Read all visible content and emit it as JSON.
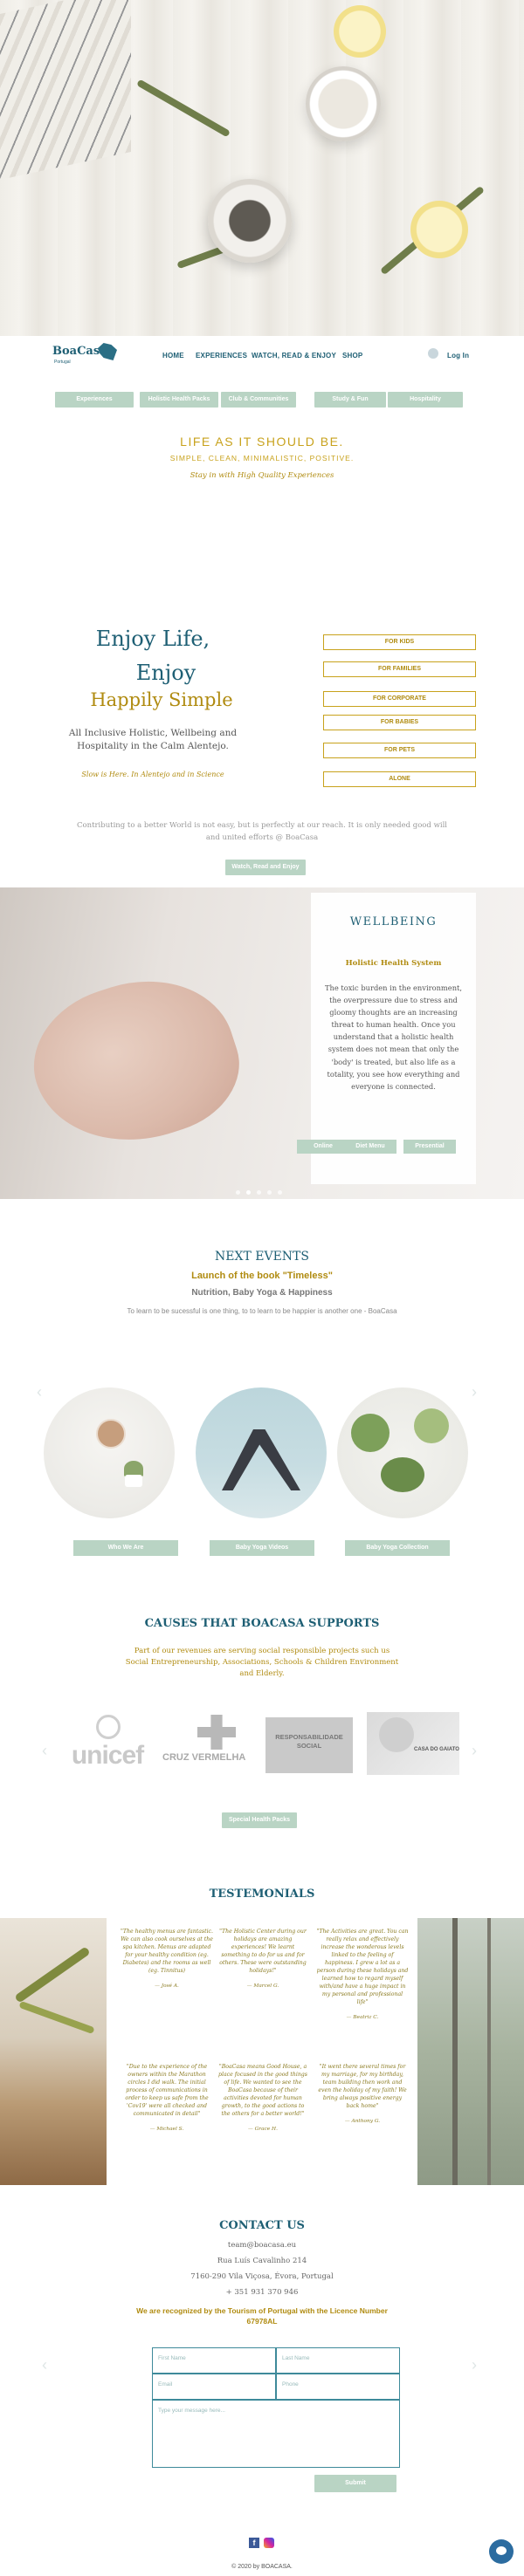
{
  "nav": {
    "logo_text": "BoaCasa",
    "logo_sub": "Portugal",
    "links": [
      "HOME",
      "EXPERIENCES",
      "WATCH, READ & ENJOY",
      "SHOP"
    ],
    "login": "Log In"
  },
  "tabs": [
    "Experiences",
    "Holistic Health Packs",
    "Club & Communities",
    "Study & Fun",
    "Hospitality"
  ],
  "intro": {
    "title": "LIFE AS IT SHOULD BE.",
    "subtitle": "SIMPLE, CLEAN, MINIMALISTIC, POSITIVE.",
    "tagline": "Stay in with High Quality Experiences"
  },
  "enjoy": {
    "line1": "Enjoy Life,",
    "line2": "Enjoy",
    "line3": "Happily Simple",
    "desc": "All Inclusive Holistic, Wellbeing and Hospitality in the Calm Alentejo.",
    "slogan": "Slow is Here. In Alentejo and in Science",
    "buttons": [
      "FOR KIDS",
      "FOR FAMILIES",
      "FOR CORPORATE",
      "FOR BABIES",
      "FOR PETS",
      "ALONE"
    ],
    "contribution": "Contributing to a better World is not easy, but is perfectly at our reach. It is only needed good will and united efforts @ BoaCasa",
    "cta": "Watch, Read and Enjoy"
  },
  "wellbeing": {
    "title": "WELLBEING",
    "subtitle": "Holistic Health System",
    "body": "The toxic burden in the environment, the overpressure due to stress and gloomy thoughts are an increasing threat to human health. Once you understand that a holistic health system does not mean that only the 'body' is treated, but also life as a totality, you see how everything and everyone is connected.",
    "buttons": [
      "Online",
      "Diet Menu",
      "Presential"
    ]
  },
  "events": {
    "title": "NEXT EVENTS",
    "launch": "Launch of the book \"Timeless\"",
    "sub": "Nutrition, Baby Yoga & Happiness",
    "quote": "To learn to be sucessful is one thing, to to learn to be happier is another one - BoaCasa",
    "buttons": [
      "Who We Are",
      "Baby Yoga Videos",
      "Baby Yoga Collection"
    ]
  },
  "causes": {
    "title": "CAUSES THAT BOACASA SUPPORTS",
    "text": "Part of our revenues are serving social responsible projects such us Social Entrepreneurship, Associations, Schools & Children Environment and Elderly.",
    "logos": [
      "unicef",
      "CRUZ VERMELHA",
      "RESPONSABILIDADE SOCIAL",
      "CASA DO GAIATO"
    ],
    "cta": "Special Health Packs"
  },
  "testimonials": {
    "title": "TESTEMONIALS",
    "items": [
      {
        "text": "\"The healthy menus are fantastic. We can also cook ourselves at the spa kitchen. Menus are adapted for your healthy condition (eg. Diabetes) and the rooms as well (eg. Tinnitus)",
        "name": "— José A."
      },
      {
        "text": "\"The Holistic Center during our holidays are amazing experiences!   We learnt something to do for us and for others. These were outstanding holidays!\"",
        "name": "— Marcel G."
      },
      {
        "text": "\"The Activities are great. You can really relax and effectively increase the wonderous levels linked to the feeling of happiness. I grew a lot as a person during these holidays and learned how to regard myself with/and have a huge impact in my personal and professional life\"",
        "name": "— Beatriz C."
      },
      {
        "text": "\"Due to the experience of the owners within the Marathon circles I did walk. The initial process of communications in order to keep us safe from the 'Cov19' were all checked and communicated in detail\"",
        "name": "— Michael S."
      },
      {
        "text": "\"BoaCasa means Good House, a place focused in the good things of life.  We wanted to see the BoaCasa because of their activities devoted for human growth, to the good actions to the others for a better world!\"",
        "name": "— Grace H."
      },
      {
        "text": "\"It went there several times for my marriage, for my birthday, team building then work and even the holiday of my faith! We bring always positive energy back home\"",
        "name": "— Anthony G."
      }
    ]
  },
  "contact": {
    "title": "CONTACT US",
    "email": "team@boacasa.eu",
    "street": "Rua Luís Cavalinho 214",
    "city": "7160-290 Vila Viçosa, Évora, Portugal",
    "phone": "+ 351 931 370 946",
    "licence": "We are recognized by the Tourism of Portugal with the Licence Number 67978AL",
    "form": {
      "first_name": "First Name",
      "last_name": "Last Name",
      "email": "Email",
      "phone": "Phone",
      "message": "Type your message here...",
      "submit": "Submit"
    }
  },
  "footer": {
    "copyright": "© 2020 by BOACASA."
  },
  "colors": {
    "teal": "#1e5f74",
    "gold": "#c8a21c",
    "mint": "#b9d4c4"
  }
}
